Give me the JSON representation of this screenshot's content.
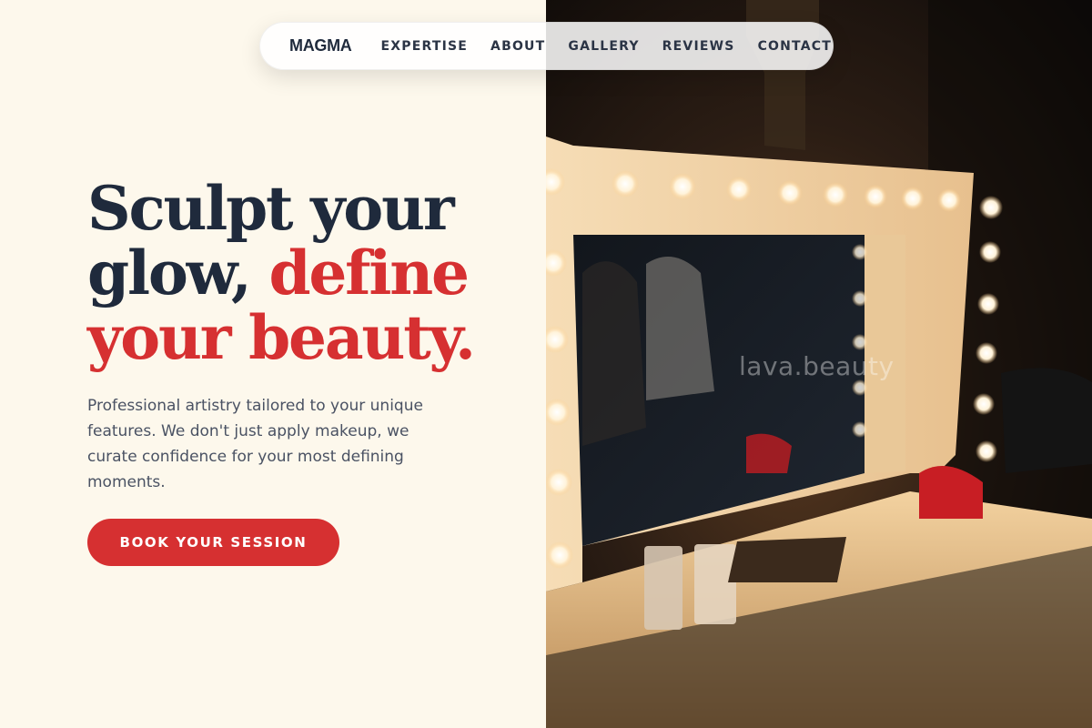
{
  "nav": {
    "brand": "MAGMA",
    "links": [
      "EXPERTISE",
      "ABOUT",
      "GALLERY",
      "REVIEWS",
      "CONTACT"
    ]
  },
  "hero": {
    "headline_line1": "Sculpt your",
    "headline_line2_a": "glow, ",
    "headline_line2_b": "define",
    "headline_line3": "your beauty.",
    "subtitle": "Professional artistry tailored to your unique features. We don't just apply makeup, we curate confidence for your most defining moments.",
    "cta_label": "BOOK YOUR SESSION"
  },
  "image": {
    "watermark": "lava.beauty",
    "subject": "illuminated vanity mirror with makeup table"
  },
  "colors": {
    "background": "#fdf8ec",
    "navy": "#1f2a3c",
    "accent": "#d63031",
    "body_text": "#4a5263"
  }
}
